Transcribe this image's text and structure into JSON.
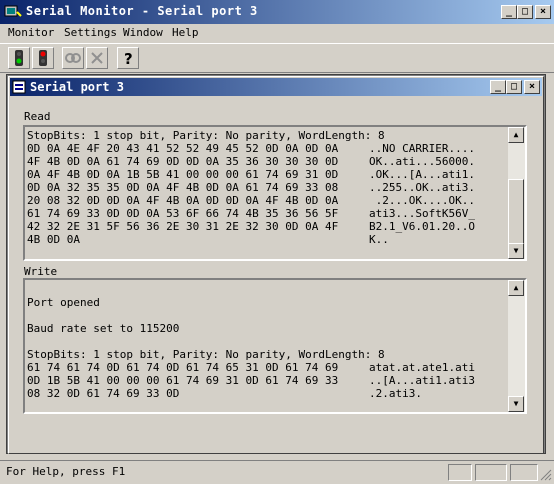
{
  "window": {
    "title": "Serial Monitor - Serial port 3",
    "min": "_",
    "max": "□",
    "close": "×"
  },
  "menu": [
    "Monitor",
    "Settings",
    "Window",
    "Help"
  ],
  "toolbar": {
    "help_label": "?"
  },
  "child": {
    "title": "Serial port 3",
    "min": "_",
    "max": "□",
    "close": "×"
  },
  "read": {
    "label": "Read",
    "header": "StopBits: 1 stop bit, Parity: No parity, WordLength: 8",
    "rows": [
      {
        "hex": "0D 0A 4E 4F 20 43 41 52 52 49 45 52 0D 0A 0D 0A",
        "ascii": "..NO CARRIER...."
      },
      {
        "hex": "4F 4B 0D 0A 61 74 69 0D 0D 0A 35 36 30 30 30 0D",
        "ascii": "OK..ati...56000."
      },
      {
        "hex": "0A 4F 4B 0D 0A 1B 5B 41 00 00 00 61 74 69 31 0D",
        "ascii": ".OK...[A...ati1."
      },
      {
        "hex": "0D 0A 32 35 35 0D 0A 4F 4B 0D 0A 61 74 69 33 08",
        "ascii": "..255..OK..ati3."
      },
      {
        "hex": "20 08 32 0D 0D 0A 4F 4B 0A 0D 0D 0A 4F 4B 0D 0A",
        "ascii": " .2...OK....OK.."
      },
      {
        "hex": "61 74 69 33 0D 0D 0A 53 6F 66 74 4B 35 36 56 5F",
        "ascii": "ati3...SoftK56V_"
      },
      {
        "hex": "42 32 2E 31 5F 56 36 2E 30 31 2E 32 30 0D 0A 4F",
        "ascii": "B2.1_V6.01.20..O"
      },
      {
        "hex": "4B 0D 0A",
        "ascii": "K.."
      }
    ]
  },
  "write": {
    "label": "Write",
    "line1": "Port opened",
    "line2": "Baud rate set to 115200",
    "header": "StopBits: 1 stop bit, Parity: No parity, WordLength: 8",
    "rows": [
      {
        "hex": "61 74 61 74 0D 61 74 0D 61 74 65 31 0D 61 74 69",
        "ascii": "atat.at.ate1.ati"
      },
      {
        "hex": "0D 1B 5B 41 00 00 00 61 74 69 31 0D 61 74 69 33",
        "ascii": "..[A...ati1.ati3"
      },
      {
        "hex": "08 32 0D 61 74 69 33 0D",
        "ascii": ".2.ati3."
      }
    ]
  },
  "status": {
    "text": "For Help, press F1"
  }
}
